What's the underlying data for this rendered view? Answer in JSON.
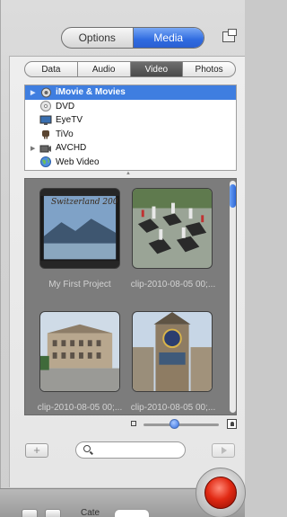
{
  "top_tabs": [
    {
      "label": "Options",
      "active": false
    },
    {
      "label": "Media",
      "active": true
    }
  ],
  "media_tabs": [
    {
      "label": "Data",
      "active": false
    },
    {
      "label": "Audio",
      "active": false
    },
    {
      "label": "Video",
      "active": true
    },
    {
      "label": "Photos",
      "active": false
    }
  ],
  "sources": [
    {
      "label": "iMovie & Movies",
      "icon": "imovie-icon",
      "expandable": true,
      "selected": true
    },
    {
      "label": "DVD",
      "icon": "dvd-icon",
      "expandable": false,
      "selected": false
    },
    {
      "label": "EyeTV",
      "icon": "eyetv-icon",
      "expandable": false,
      "selected": false
    },
    {
      "label": "TiVo",
      "icon": "tivo-icon",
      "expandable": false,
      "selected": false
    },
    {
      "label": "AVCHD",
      "icon": "avchd-icon",
      "expandable": true,
      "selected": false
    },
    {
      "label": "Web Video",
      "icon": "globe-icon",
      "expandable": false,
      "selected": false
    }
  ],
  "thumbnails": [
    {
      "label": "My First Project",
      "overlay_text": "Switzerland 200"
    },
    {
      "label": "clip-2010-08-05 00;..."
    },
    {
      "label": "clip-2010-08-05 00;..."
    },
    {
      "label": "clip-2010-08-05 00;..."
    }
  ],
  "search": {
    "placeholder": ""
  },
  "bottom_bar": {
    "label": "Cate"
  },
  "colors": {
    "accent": "#2f6be0",
    "selection": "#3f7ee0",
    "record": "#e12a14",
    "grid_bg": "#7c7c7c"
  }
}
